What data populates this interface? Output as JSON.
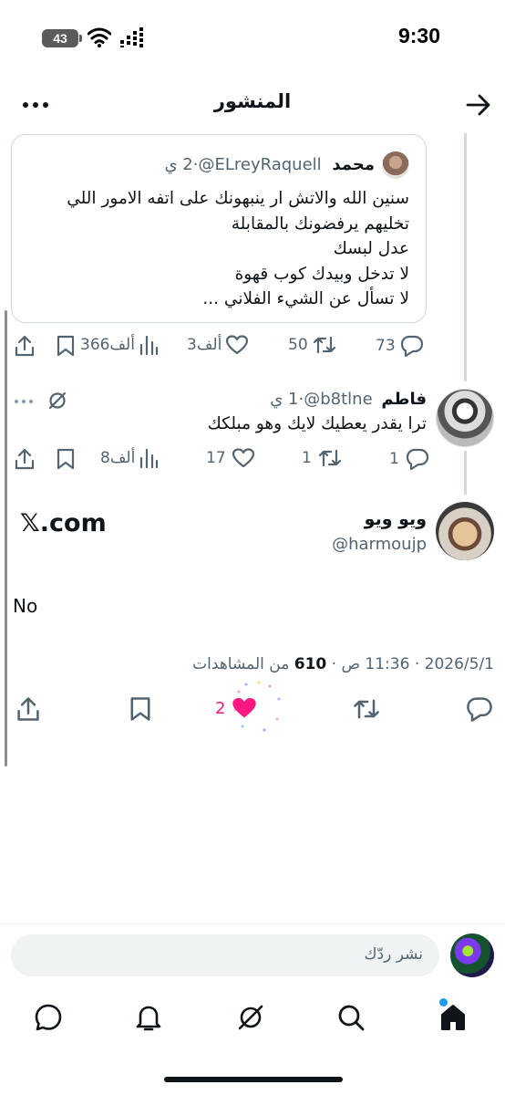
{
  "status_bar": {
    "time": "9:30",
    "battery": "43"
  },
  "header": {
    "title": "المنشور"
  },
  "quoted_post": {
    "name": "محمد",
    "handle": "@ELreyRaquell",
    "time": "2 ي",
    "separator": "·",
    "lines": [
      "سنين الله والاتش ار ينبهونك على اتفه الامور  اللي",
      "تخليهم يرفضونك بالمقابلة",
      "عدل لبسك",
      "لا تدخل وبيدك كوب قهوة",
      "لا تسأل عن الشيء الفلاني ..."
    ],
    "replies": "73",
    "reposts": "50",
    "likes": "3ألف",
    "views": "366ألف"
  },
  "reply_post": {
    "name": "فاطم",
    "handle": "@b8tlne",
    "time": "1 ي",
    "separator": "·",
    "text": "ترا يقدر يعطيك لايك وهو مبلكك",
    "replies": "1",
    "reposts": "1",
    "likes": "17",
    "views": "8ألف"
  },
  "main_post": {
    "name": "ويو ويو",
    "handle": "@harmoujp",
    "source": "𝕏.com",
    "text": "No",
    "date": "2026/5/1",
    "time": "11:36 ص",
    "dot": " · ",
    "views": "610",
    "views_label": "من المشاهدات",
    "likes": "2"
  },
  "reply_box": {
    "placeholder": "نشر ردّك"
  },
  "colors": {
    "like_pink": "#f91880",
    "notification_blue": "#1d9bf0",
    "text_gray": "#536471"
  }
}
